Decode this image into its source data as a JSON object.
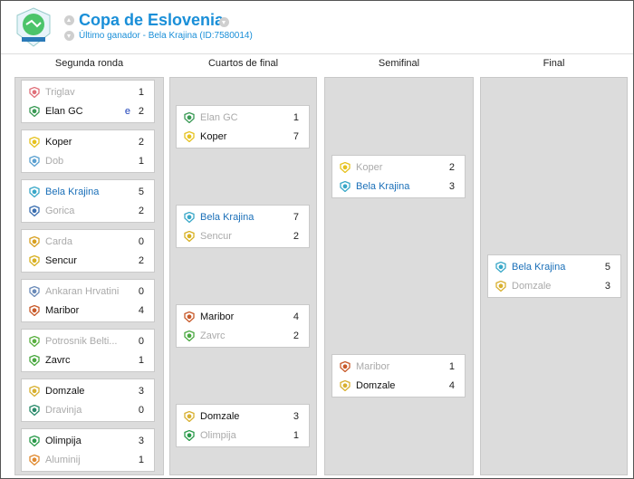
{
  "header": {
    "title": "Copa de Eslovenia",
    "subtitle": "Último ganador - Bela Krajina (ID:7580014)"
  },
  "columns": [
    {
      "label": "Segunda ronda"
    },
    {
      "label": "Cuartos de final"
    },
    {
      "label": "Semifinal"
    },
    {
      "label": "Final"
    }
  ],
  "colors": {
    "accent": "#1a8fd8",
    "champion": "#1a6fb8",
    "loser": "#aaaaaa",
    "extra_time": "#1a3fb8"
  },
  "rounds": {
    "r2": [
      {
        "home": {
          "name": "Triglav",
          "score": "1",
          "state": "lose",
          "crest": "#e0707a"
        },
        "away": {
          "name": "Elan GC",
          "score": "2",
          "state": "win",
          "crest": "#3a9a55",
          "extra": "e"
        }
      },
      {
        "home": {
          "name": "Koper",
          "score": "2",
          "state": "win",
          "crest": "#e6c21f"
        },
        "away": {
          "name": "Dob",
          "score": "1",
          "state": "lose",
          "crest": "#5aa0d0"
        }
      },
      {
        "home": {
          "name": "Bela Krajina",
          "score": "5",
          "state": "champ",
          "crest": "#3aa8c8"
        },
        "away": {
          "name": "Gorica",
          "score": "2",
          "state": "lose",
          "crest": "#3b6fb0"
        }
      },
      {
        "home": {
          "name": "Carda",
          "score": "0",
          "state": "lose",
          "crest": "#d8a020"
        },
        "away": {
          "name": "Sencur",
          "score": "2",
          "state": "win",
          "crest": "#d8b020"
        }
      },
      {
        "home": {
          "name": "Ankaran Hrvatini",
          "score": "0",
          "state": "lose",
          "crest": "#6a8ab8"
        },
        "away": {
          "name": "Maribor",
          "score": "4",
          "state": "win",
          "crest": "#c85a2a"
        }
      },
      {
        "home": {
          "name": "Potrosnik Belti...",
          "score": "0",
          "state": "lose",
          "crest": "#5ab040"
        },
        "away": {
          "name": "Zavrc",
          "score": "1",
          "state": "win",
          "crest": "#4aa840"
        }
      },
      {
        "home": {
          "name": "Domzale",
          "score": "3",
          "state": "win",
          "crest": "#d8b030"
        },
        "away": {
          "name": "Dravinja",
          "score": "0",
          "state": "lose",
          "crest": "#2a8a6a"
        }
      },
      {
        "home": {
          "name": "Olimpija",
          "score": "3",
          "state": "win",
          "crest": "#2a9a4a"
        },
        "away": {
          "name": "Aluminij",
          "score": "1",
          "state": "lose",
          "crest": "#e08a30"
        }
      }
    ],
    "qf": [
      {
        "home": {
          "name": "Elan GC",
          "score": "1",
          "state": "lose",
          "crest": "#3a9a55"
        },
        "away": {
          "name": "Koper",
          "score": "7",
          "state": "win",
          "crest": "#e6c21f"
        }
      },
      {
        "home": {
          "name": "Bela Krajina",
          "score": "7",
          "state": "champ",
          "crest": "#3aa8c8"
        },
        "away": {
          "name": "Sencur",
          "score": "2",
          "state": "lose",
          "crest": "#d8b020"
        }
      },
      {
        "home": {
          "name": "Maribor",
          "score": "4",
          "state": "win",
          "crest": "#c85a2a"
        },
        "away": {
          "name": "Zavrc",
          "score": "2",
          "state": "lose",
          "crest": "#4aa840"
        }
      },
      {
        "home": {
          "name": "Domzale",
          "score": "3",
          "state": "win",
          "crest": "#d8b030"
        },
        "away": {
          "name": "Olimpija",
          "score": "1",
          "state": "lose",
          "crest": "#2a9a4a"
        }
      }
    ],
    "sf": [
      {
        "home": {
          "name": "Koper",
          "score": "2",
          "state": "lose",
          "crest": "#e6c21f"
        },
        "away": {
          "name": "Bela Krajina",
          "score": "3",
          "state": "champ",
          "crest": "#3aa8c8"
        }
      },
      {
        "home": {
          "name": "Maribor",
          "score": "1",
          "state": "lose",
          "crest": "#c85a2a"
        },
        "away": {
          "name": "Domzale",
          "score": "4",
          "state": "win",
          "crest": "#d8b030"
        }
      }
    ],
    "final": [
      {
        "home": {
          "name": "Bela Krajina",
          "score": "5",
          "state": "champ",
          "crest": "#3aa8c8"
        },
        "away": {
          "name": "Domzale",
          "score": "3",
          "state": "lose",
          "crest": "#d8b030"
        }
      }
    ]
  }
}
